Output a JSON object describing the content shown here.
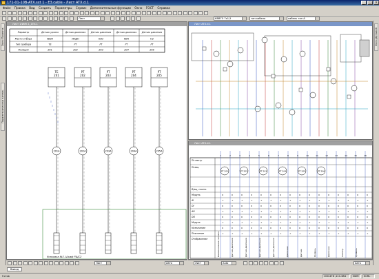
{
  "window": {
    "title": "171-01-10B-ATX.sxt 1 - E3.cable - Лист ATX.d.1"
  },
  "menu": [
    "Файл",
    "Правка",
    "Вид",
    "Создать",
    "Параметры",
    "Сервис",
    "Дополнительные функции",
    "Окно",
    "ГОСТ",
    "Справка"
  ],
  "toolbar": {
    "combo1": "Лист",
    "combo2": "КВВГЭ 7х1,5",
    "combo3": "тип кабеля",
    "combo4": "кабель тип A"
  },
  "left_tabs": [
    "Окно Проекта",
    "Параметрическая панель"
  ],
  "right_tabs": [
    "Окно Деталей"
  ],
  "left_doc": {
    "title": "Лист 1/ИИУ-1_ATX-1",
    "header": [
      "Параметр",
      "Датчик уровня",
      "Датчик давления",
      "Датчик давления",
      "Датчик давления",
      "Датчик давления"
    ],
    "rows": [
      {
        "label": "Место отбора",
        "cells": [
          "УВЗН",
          "ИЛДН",
          "КВ3",
          "КВН",
          "Н2"
        ]
      },
      {
        "label": "Тип прибора",
        "cells": [
          "ТЕ",
          "РТ",
          "РТ",
          "РТ",
          "РТ"
        ]
      },
      {
        "label": "Позиция",
        "cells": [
          "201",
          "202",
          "203",
          "204",
          "205"
        ]
      }
    ],
    "devices": [
      {
        "type": "ТЕ",
        "pos": "201",
        "junction": "201А"
      },
      {
        "type": "РТ",
        "pos": "202",
        "junction": "202А"
      },
      {
        "type": "РТ",
        "pos": "203",
        "junction": "203А"
      },
      {
        "type": "РТ",
        "pos": "204",
        "junction": "204А"
      },
      {
        "type": "РТ",
        "pos": "205",
        "junction": "205А"
      }
    ],
    "footer": "Упаковка №2. Шкаф РЩС2"
  },
  "right_doc": {
    "title": "Лист ATX.d.1",
    "title2": "Лист ATX.d.1",
    "row_labels": [
      "По месту",
      "Позиц.",
      "",
      "В/ящ, скоеть",
      "Модуль",
      "AI",
      "DI",
      "AO",
      "DO",
      "Модуль",
      "Назначение",
      "Пояснение",
      "Отображение"
    ],
    "circles": [
      "PT 201",
      "PT 202",
      "РТ 203",
      "PT 204",
      "РТ 205",
      "РТ 206"
    ],
    "bottom_labels": [
      "Наименование сигнала",
      "Датчик давления",
      "Датчик давления",
      "Датчик давления",
      "Датчик давления",
      "Давление",
      "Датчик",
      "Уровень",
      "Давление",
      "Темпер.",
      "Уровень"
    ]
  },
  "statusbar": {
    "ready": "Готов",
    "coords": "100.476 ,111.384",
    "mode1": "NUM",
    "mode2": "SCRL"
  },
  "bottom_tab": "Вывод",
  "drawtb_combo": "Лист",
  "drawtb_combo2": "Авто",
  "drawtb_combo3": "Auto"
}
